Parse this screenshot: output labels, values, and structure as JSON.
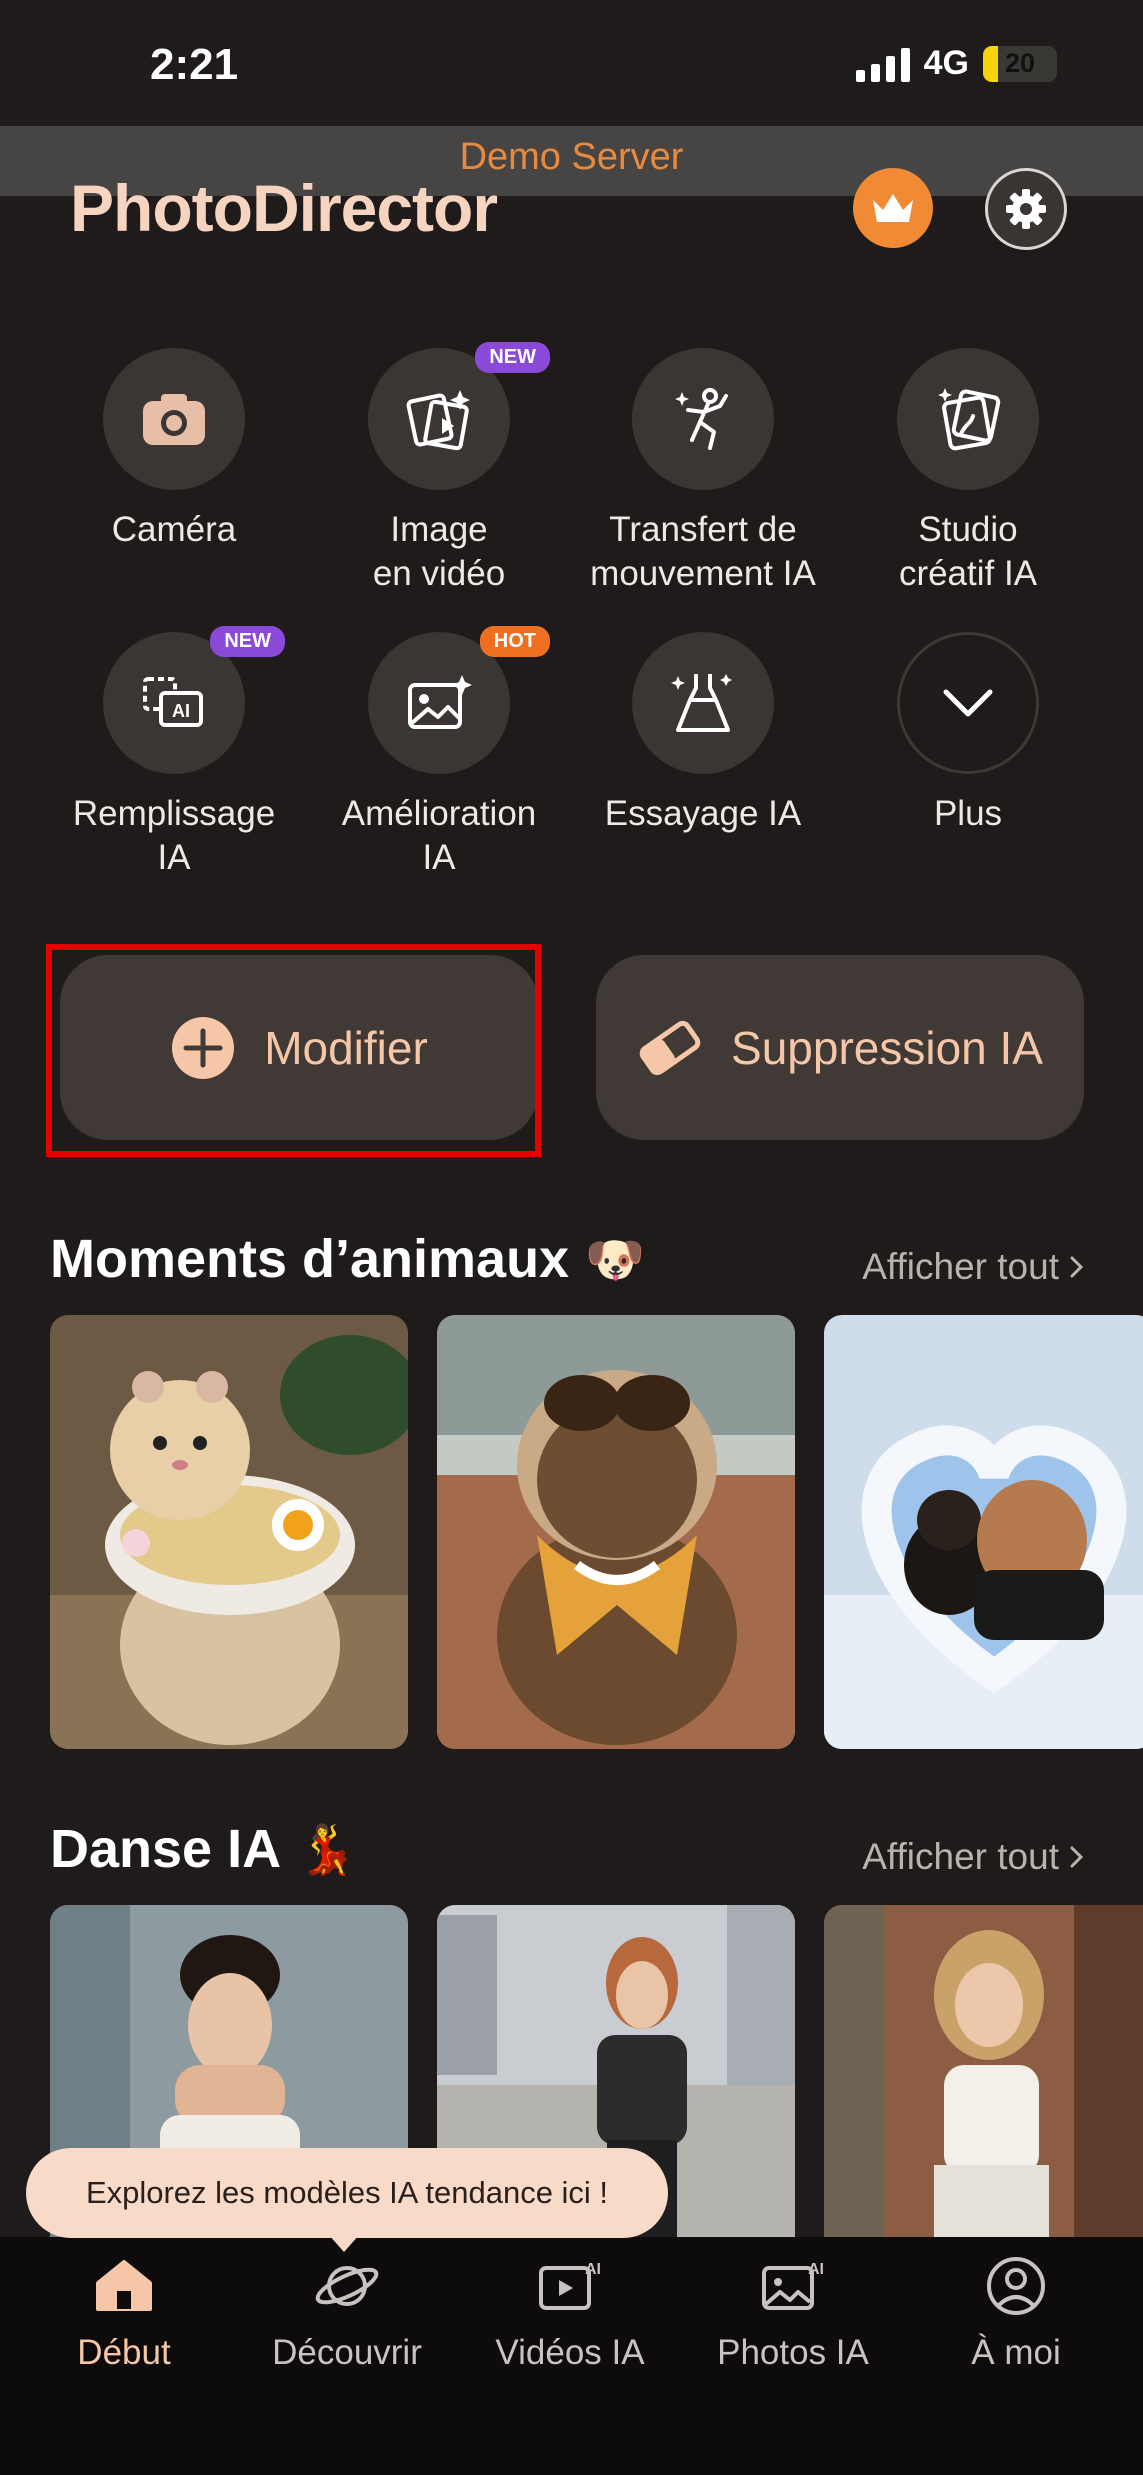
{
  "status": {
    "time": "2:21",
    "network": "4G",
    "battery": "20"
  },
  "demo_server": "Demo Server",
  "app_title": "PhotoDirector",
  "tools": [
    {
      "label_1": "Caméra",
      "label_2": "",
      "badge": ""
    },
    {
      "label_1": "Image",
      "label_2": "en vidéo",
      "badge": "NEW"
    },
    {
      "label_1": "Transfert de",
      "label_2": "mouvement IA",
      "badge": ""
    },
    {
      "label_1": "Studio",
      "label_2": "créatif IA",
      "badge": ""
    },
    {
      "label_1": "Remplissage",
      "label_2": "IA",
      "badge": "NEW"
    },
    {
      "label_1": "Amélioration",
      "label_2": "IA",
      "badge": "HOT"
    },
    {
      "label_1": "Essayage IA",
      "label_2": "",
      "badge": ""
    },
    {
      "label_1": "Plus",
      "label_2": "",
      "badge": ""
    }
  ],
  "buttons": {
    "edit": "Modifier",
    "remove": "Suppression IA"
  },
  "sections": [
    {
      "title": "Moments d’animaux",
      "emoji": "🐶",
      "see_all": "Afficher tout"
    },
    {
      "title": "Danse IA",
      "emoji": "💃",
      "see_all": "Afficher tout"
    }
  ],
  "tooltip": "Explorez les modèles IA tendance ici !",
  "nav": [
    {
      "label": "Début"
    },
    {
      "label": "Découvrir"
    },
    {
      "label": "Vidéos IA"
    },
    {
      "label": "Photos IA"
    },
    {
      "label": "À moi"
    }
  ],
  "colors": {
    "accent": "#f08a35",
    "highlight": "#e30000",
    "background": "#1f1b1a"
  }
}
